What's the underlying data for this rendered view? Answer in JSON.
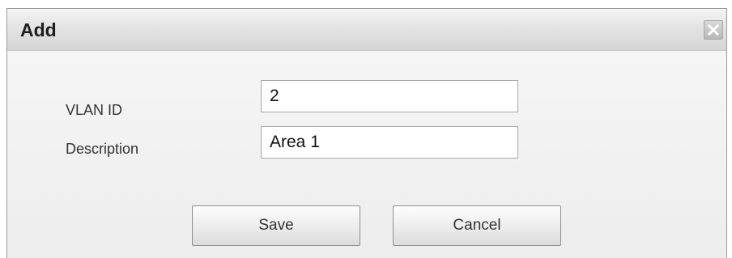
{
  "dialog": {
    "title": "Add",
    "close_icon": "close-icon"
  },
  "form": {
    "vlan_id": {
      "label": "VLAN ID",
      "value": "2"
    },
    "description": {
      "label": "Description",
      "value": "Area 1"
    }
  },
  "buttons": {
    "save_label": "Save",
    "cancel_label": "Cancel"
  },
  "colors": {
    "title_bar": "#dcdcdc",
    "dialog_bg": "#f2f2f2",
    "close_icon_bg": "#bdbdbd",
    "close_icon_glyph": "#ffffff"
  }
}
